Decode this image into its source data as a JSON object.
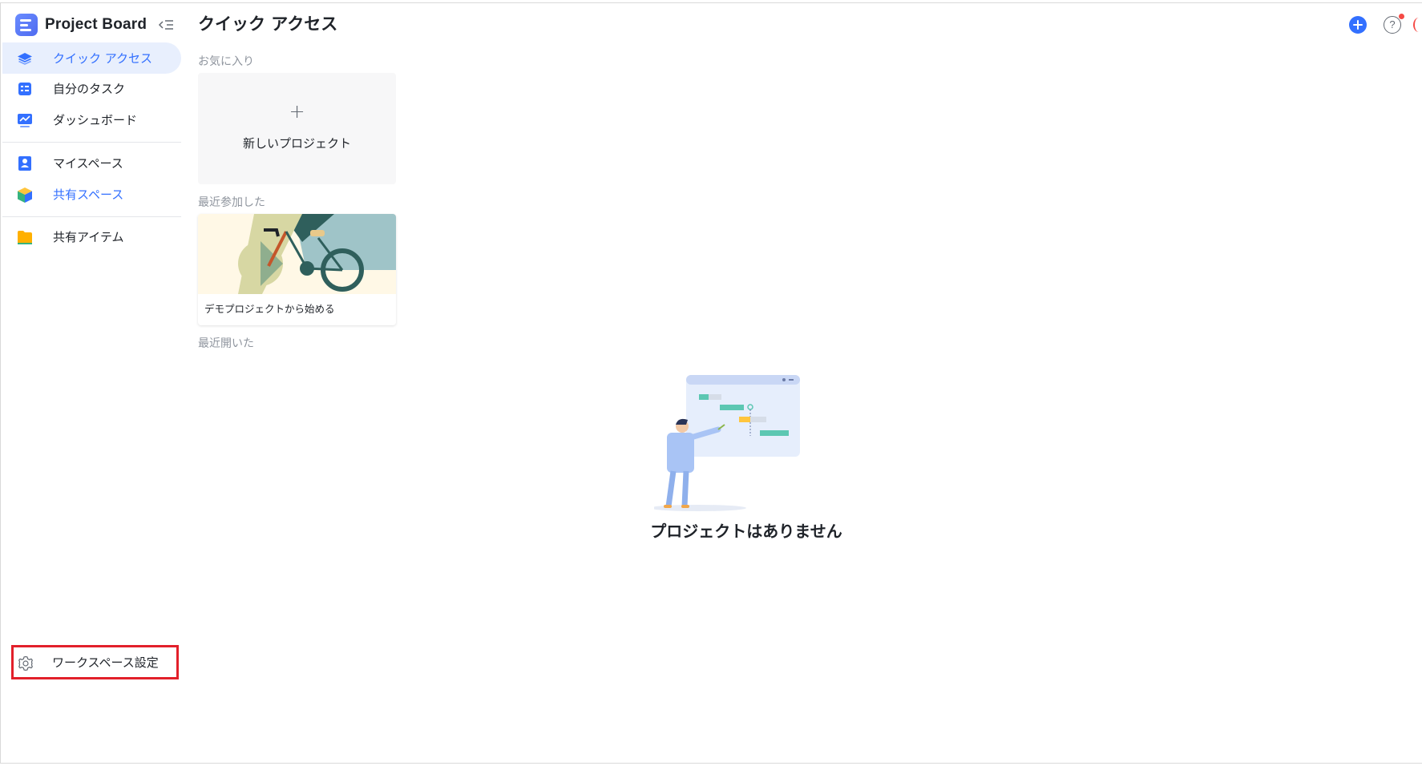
{
  "app": {
    "title": "Project Board"
  },
  "sidebar": {
    "items": [
      {
        "label": "クイック アクセス",
        "icon": "layers-icon",
        "active": true
      },
      {
        "label": "自分のタスク",
        "icon": "task-list-icon"
      },
      {
        "label": "ダッシュボード",
        "icon": "dashboard-chart-icon"
      },
      {
        "label": "マイスペース",
        "icon": "my-space-icon"
      },
      {
        "label": "共有スペース",
        "icon": "shared-space-cube-icon"
      },
      {
        "label": "共有アイテム",
        "icon": "folder-icon"
      }
    ],
    "settings_label": "ワークスペース設定",
    "settings_icon": "gear-icon"
  },
  "main": {
    "title": "クイック アクセス",
    "favorites_label": "お気に入り",
    "new_project_plus": "+",
    "new_project_label": "新しいプロジェクト",
    "recently_joined_label": "最近参加した",
    "demo_card_label": "デモプロジェクトから始める",
    "recently_opened_label": "最近開いた",
    "empty_text": "プロジェクトはありません",
    "help_symbol": "?"
  },
  "colors": {
    "accent": "#3370ff",
    "active_bg": "#e8effd",
    "highlight_border": "#e2202a",
    "notification_dot": "#f54a45"
  }
}
